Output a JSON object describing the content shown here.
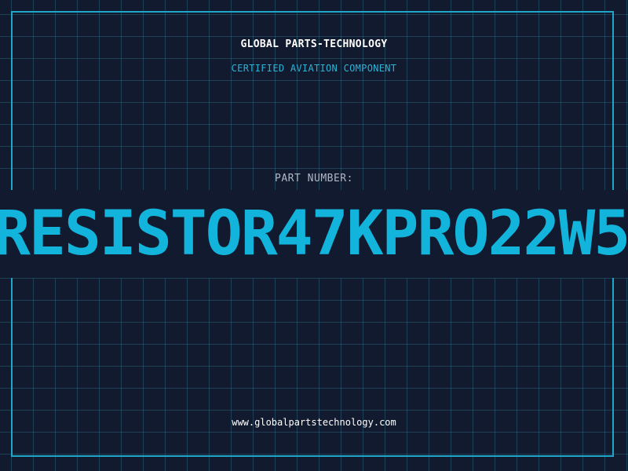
{
  "header": {
    "company": "GLOBAL PARTS-TECHNOLOGY",
    "subtitle": "CERTIFIED AVIATION COMPONENT"
  },
  "part": {
    "label": "PART NUMBER:",
    "number": "RESISTOR47KPRO22W5"
  },
  "footer": {
    "url": "www.globalpartstechnology.com"
  },
  "colors": {
    "background": "#111a2e",
    "grid": "#285f78",
    "frame": "#1fa6c8",
    "accent": "#12b4dc",
    "label": "#aeb8c9"
  }
}
